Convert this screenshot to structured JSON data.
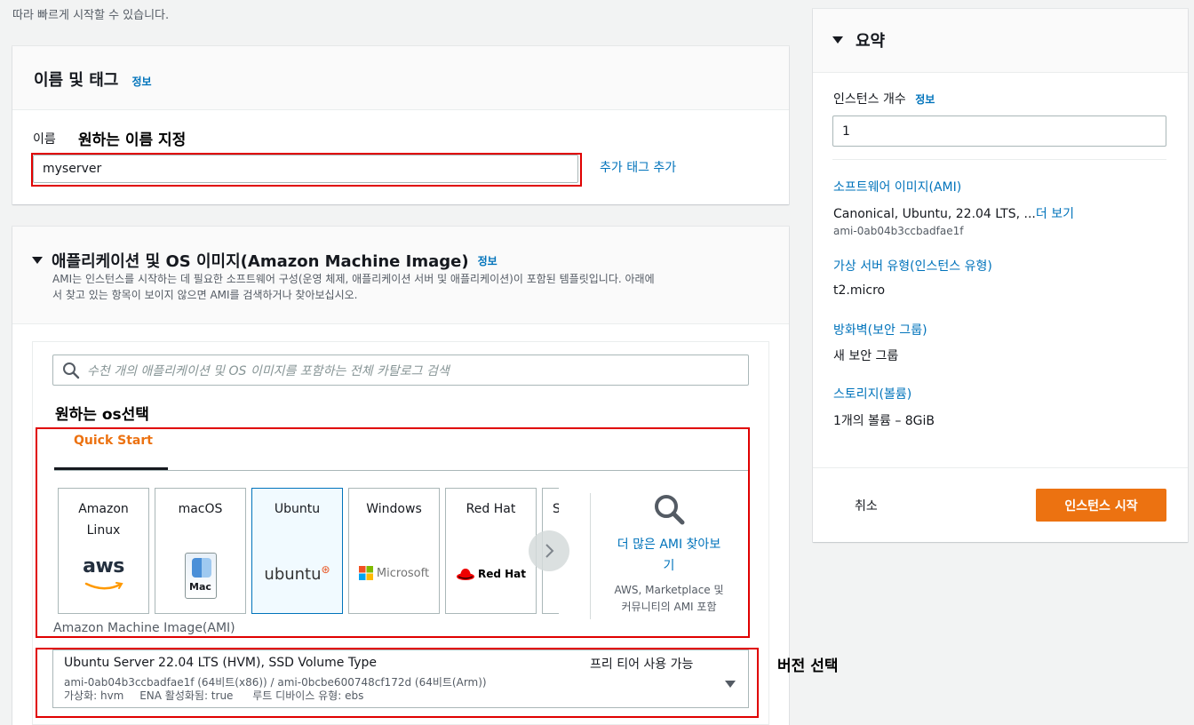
{
  "top_note": "따라 빠르게 시작할 수 있습니다.",
  "name_section": {
    "title": "이름 및 태그",
    "info": "정보",
    "name_label": "이름",
    "annotation": "원하는 이름 지정",
    "name_value": "myserver",
    "add_tag": "추가 태그 추가"
  },
  "ami_section": {
    "title": "애플리케이션 및 OS 이미지(Amazon Machine Image)",
    "info": "정보",
    "desc_line1": "AMI는 인스턴스를 시작하는 데 필요한 소프트웨어 구성(운영 체제, 애플리케이션 서버 및 애플리케이션)이 포함된 템플릿입니다. 아래에",
    "desc_line2": "서 찾고 있는 항목이 보이지 않으면 AMI를 검색하거나 찾아보십시오.",
    "search_placeholder": "수천 개의 애플리케이션 및 OS 이미지를 포함하는 전체 카탈로그 검색",
    "annotation_os": "원하는 os선택",
    "tab_quickstart": "Quick Start",
    "tiles": [
      {
        "name_line1": "Amazon",
        "name_line2": "Linux",
        "logo": "aws"
      },
      {
        "name_line1": "macOS",
        "name_line2": "",
        "logo": "Mac"
      },
      {
        "name_line1": "Ubuntu",
        "name_line2": "",
        "logo": "ubuntu"
      },
      {
        "name_line1": "Windows",
        "name_line2": "",
        "logo": "Microsoft"
      },
      {
        "name_line1": "Red Hat",
        "name_line2": "",
        "logo": "Red Hat"
      },
      {
        "name_line1": "S",
        "name_line2": "",
        "logo": ""
      }
    ],
    "browse_more_line1": "더 많은 AMI 찾아보",
    "browse_more_line2": "기",
    "browse_more_sub1": "AWS, Marketplace 및",
    "browse_more_sub2": "커뮤니티의 AMI 포함",
    "ami_label": "Amazon Machine Image(AMI)",
    "annotation_version": "버전 선택",
    "selected_ami": {
      "name": "Ubuntu Server 22.04 LTS (HVM), SSD Volume Type",
      "free_tier": "프리 티어 사용 가능",
      "ids": "ami-0ab04b3ccbadfae1f (64비트(x86)) / ami-0bcbe600748cf172d (64비트(Arm))",
      "virt": "가상화: hvm",
      "ena": "ENA 활성화됨: true",
      "root": "루트 디바이스 유형: ebs"
    }
  },
  "summary": {
    "title": "요약",
    "instance_count_label": "인스턴스 개수",
    "info": "정보",
    "instance_count": "1",
    "software_image_label": "소프트웨어 이미지(AMI)",
    "software_image_value": "Canonical, Ubuntu, 22.04 LTS, ...",
    "more_link": "더 보기",
    "software_image_id": "ami-0ab04b3ccbadfae1f",
    "instance_type_label": "가상 서버 유형(인스턴스 유형)",
    "instance_type_value": "t2.micro",
    "firewall_label": "방화벽(보안 그룹)",
    "firewall_value": "새 보안 그룹",
    "storage_label": "스토리지(볼륨)",
    "storage_value": "1개의 볼륨 – 8GiB",
    "cancel": "취소",
    "launch": "인스턴스 시작"
  },
  "colors": {
    "accent": "#0073bb",
    "primary_button": "#ec7211",
    "annotation_red": "#e00000",
    "tab_active": "#ec7211"
  }
}
